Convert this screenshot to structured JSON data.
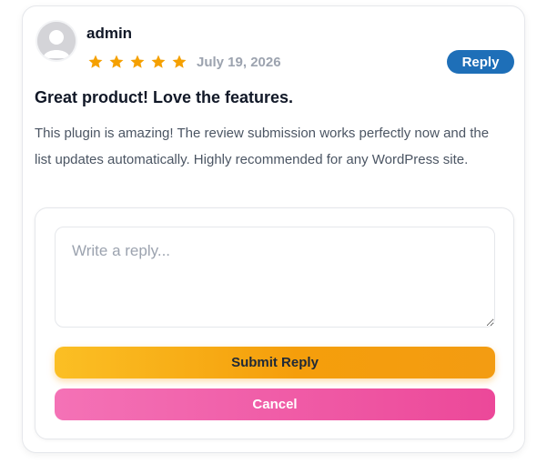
{
  "review": {
    "author": "admin",
    "rating": 5,
    "rating_max": 5,
    "date": "July 19, 2026",
    "reply_label": "Reply",
    "title": "Great product! Love the features.",
    "body": "This plugin is amazing! The review submission works perfectly now and the list updates automatically. Highly recommended for any WordPress site."
  },
  "reply_form": {
    "placeholder": "Write a reply...",
    "value": "",
    "submit_label": "Submit Reply",
    "cancel_label": "Cancel"
  },
  "icons": {
    "avatar": "user-avatar-icon",
    "star": "star-icon"
  },
  "colors": {
    "star": "#f5a000",
    "reply_button": "#1e6fb8",
    "submit_gradient_start": "#fbbf24",
    "submit_gradient_end": "#f39c12",
    "cancel_gradient_start": "#f472b6",
    "cancel_gradient_end": "#ec4899",
    "date_text": "#9ca3af"
  }
}
